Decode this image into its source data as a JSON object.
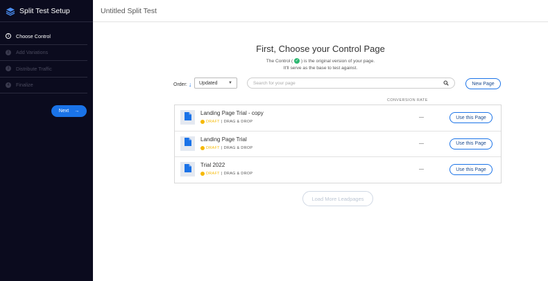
{
  "sidebar": {
    "title": "Split Test Setup",
    "steps": [
      {
        "num": "1",
        "label": "Choose Control"
      },
      {
        "num": "2",
        "label": "Add Variations"
      },
      {
        "num": "3",
        "label": "Distribute Traffic"
      },
      {
        "num": "4",
        "label": "Finalize"
      }
    ],
    "next_label": "Next",
    "next_arrow": "→"
  },
  "header": {
    "title": "Untitled Split Test"
  },
  "main": {
    "heading": "First, Choose your Control Page",
    "sub_line1_a": "The Control (",
    "sub_check": "✓",
    "sub_line1_b": ") is the original version of your page.",
    "sub_line2": "It'll serve as the base to test against.",
    "order_label": "Order:",
    "order_arrow": "↓",
    "order_value": "Updated",
    "order_chevron": "▼",
    "search_placeholder": "Search for your page",
    "new_page_label": "New Page",
    "conversion_header": "CONVERSION RATE",
    "rows": [
      {
        "name": "Landing Page Trial - copy",
        "status": "DRAFT",
        "sep": "|",
        "type": "DRAG & DROP",
        "rate": "—",
        "action": "Use this Page"
      },
      {
        "name": "Landing Page Trial",
        "status": "DRAFT",
        "sep": "|",
        "type": "DRAG & DROP",
        "rate": "—",
        "action": "Use this Page"
      },
      {
        "name": "Trial 2022",
        "status": "DRAFT",
        "sep": "|",
        "type": "DRAG & DROP",
        "rate": "—",
        "action": "Use this Page"
      }
    ],
    "load_more_label": "Load More Leadpages"
  },
  "colors": {
    "sidebar_bg": "#0b0b1e",
    "accent": "#1a73e8",
    "draft": "#f5b800",
    "control_check": "#2eb872"
  },
  "icons": {
    "logo": "layers-logo-icon",
    "search": "search-icon",
    "page": "document-icon",
    "next": "arrow-right-icon",
    "sort": "arrow-down-icon"
  }
}
